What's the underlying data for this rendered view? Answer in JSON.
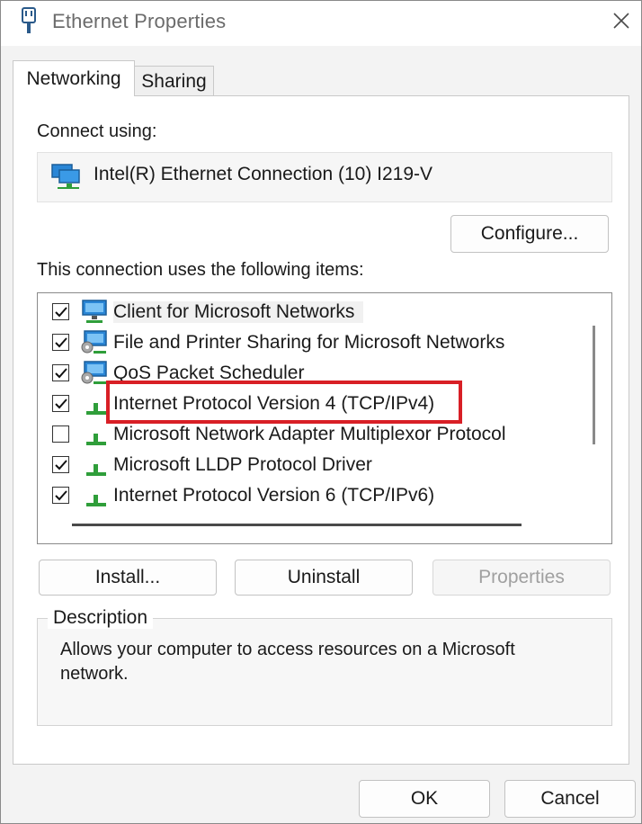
{
  "window": {
    "title": "Ethernet Properties",
    "icons": {
      "app": "ethernet-plug-icon",
      "close": "close-icon"
    }
  },
  "tabs": [
    {
      "label": "Networking",
      "selected": true
    },
    {
      "label": "Sharing",
      "selected": false
    }
  ],
  "connect_using": {
    "label": "Connect using:",
    "adapter": "Intel(R) Ethernet Connection (10) I219-V",
    "icon": "network-adapter-icon"
  },
  "configure_button": "Configure...",
  "items_label": "This connection uses the following items:",
  "items": [
    {
      "label": "Client for Microsoft Networks",
      "checked": true,
      "icon": "network-client-icon",
      "selected": true
    },
    {
      "label": "File and Printer Sharing for Microsoft Networks",
      "checked": true,
      "icon": "network-service-icon",
      "selected": false
    },
    {
      "label": "QoS Packet Scheduler",
      "checked": true,
      "icon": "network-service-icon",
      "selected": false
    },
    {
      "label": "Internet Protocol Version 4 (TCP/IPv4)",
      "checked": true,
      "icon": "protocol-icon",
      "selected": false,
      "highlighted": true
    },
    {
      "label": "Microsoft Network Adapter Multiplexor Protocol",
      "checked": false,
      "icon": "protocol-icon",
      "selected": false
    },
    {
      "label": "Microsoft LLDP Protocol Driver",
      "checked": true,
      "icon": "protocol-icon",
      "selected": false
    },
    {
      "label": "Internet Protocol Version 6 (TCP/IPv6)",
      "checked": true,
      "icon": "protocol-icon",
      "selected": false
    }
  ],
  "buttons": {
    "install": "Install...",
    "uninstall": "Uninstall",
    "properties": "Properties",
    "ok": "OK",
    "cancel": "Cancel"
  },
  "description": {
    "title": "Description",
    "text": "Allows your computer to access resources on a Microsoft network."
  },
  "colors": {
    "highlight": "#d81f26",
    "protocol_green": "#2f9e3a",
    "monitor_blue": "#2a86d6"
  }
}
